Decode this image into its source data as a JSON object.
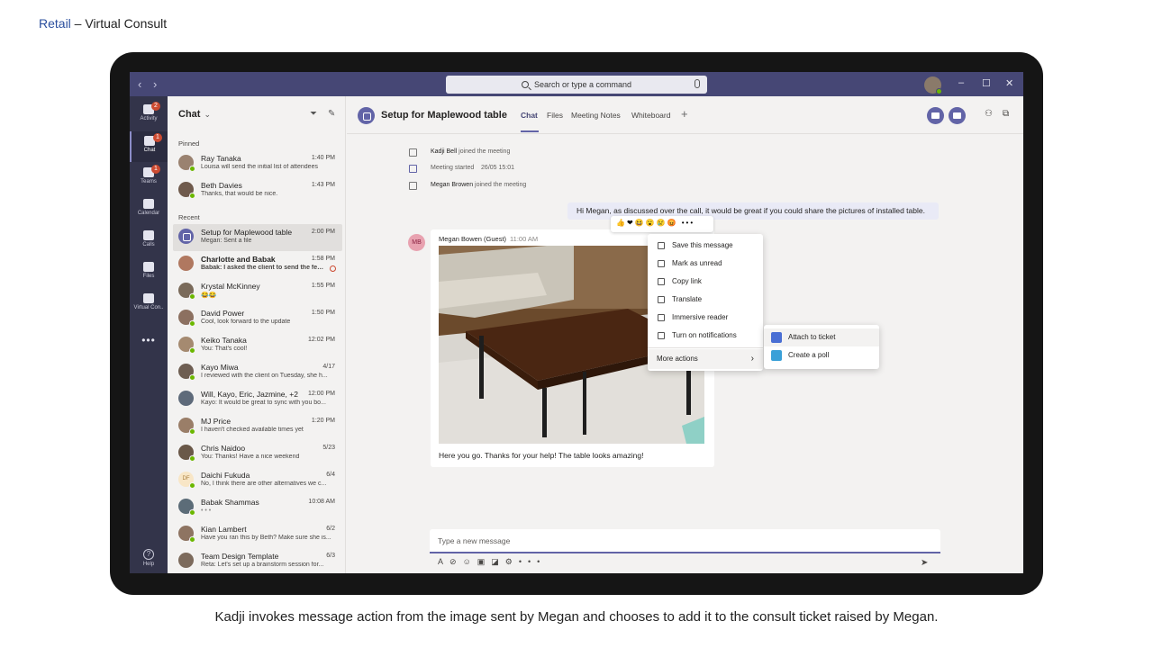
{
  "slide": {
    "title_accent": "Retail",
    "title_rest": " – Virtual Consult",
    "caption": "Kadji invokes message action from the image sent by Megan and chooses to add it to the consult ticket raised by Megan."
  },
  "titlebar": {
    "search_placeholder": "Search or type a command"
  },
  "rail": {
    "items": [
      {
        "label": "Activity",
        "icon": "bell-icon",
        "badge": "2"
      },
      {
        "label": "Chat",
        "icon": "chat-icon",
        "badge": "1"
      },
      {
        "label": "Teams",
        "icon": "teams-icon",
        "badge": "1"
      },
      {
        "label": "Calendar",
        "icon": "calendar-icon",
        "badge": ""
      },
      {
        "label": "Calls",
        "icon": "phone-icon",
        "badge": ""
      },
      {
        "label": "Files",
        "icon": "files-icon",
        "badge": ""
      },
      {
        "label": "Virtual Con..",
        "icon": "virtual-consult-icon",
        "badge": ""
      }
    ],
    "more": "•••",
    "help": "Help"
  },
  "chatlist": {
    "header": "Chat",
    "pinned_label": "Pinned",
    "recent_label": "Recent",
    "pinned": [
      {
        "name": "Ray Tanaka",
        "time": "1:40 PM",
        "preview": "Louisa will send the initial list of attendees"
      },
      {
        "name": "Beth Davies",
        "time": "1:43 PM",
        "preview": "Thanks, that would be nice."
      }
    ],
    "recent": [
      {
        "name": "Setup for Maplewood table",
        "time": "2:00 PM",
        "preview": "Megan: Sent a file"
      },
      {
        "name": "Charlotte and Babak",
        "time": "1:58 PM",
        "preview": "Babak: I asked the client to send the feedback"
      },
      {
        "name": "Krystal McKinney",
        "time": "1:55 PM",
        "preview": "😂😂"
      },
      {
        "name": "David Power",
        "time": "1:50 PM",
        "preview": "Cool, look forward to the update"
      },
      {
        "name": "Keiko Tanaka",
        "time": "12:02 PM",
        "preview": "You: That's cool!"
      },
      {
        "name": "Kayo Miwa",
        "time": "4/17",
        "preview": "I reviewed with the client on Tuesday, she h..."
      },
      {
        "name": "Will, Kayo, Eric, Jazmine, +2",
        "time": "12:00 PM",
        "preview": "Kayo: It would be great to sync with you bo..."
      },
      {
        "name": "MJ Price",
        "time": "1:20 PM",
        "preview": "I haven't checked available times yet"
      },
      {
        "name": "Chris Naidoo",
        "time": "5/23",
        "preview": "You: Thanks! Have a nice weekend"
      },
      {
        "name": "Daichi Fukuda",
        "time": "6/4",
        "preview": "No, I think there are other alternatives we c...",
        "initials": "DF"
      },
      {
        "name": "Babak Shammas",
        "time": "10:08 AM",
        "preview": "• • •"
      },
      {
        "name": "Kian Lambert",
        "time": "6/2",
        "preview": "Have you ran this by Beth? Make sure she is..."
      },
      {
        "name": "Team Design Template",
        "time": "6/3",
        "preview": "Reta: Let's set up a brainstorm session for..."
      }
    ]
  },
  "main": {
    "title": "Setup for Maplewood table",
    "tabs": [
      "Chat",
      "Files",
      "Meeting Notes",
      "Whiteboard"
    ],
    "system": [
      {
        "name": "Kadji Bell",
        "text": "joined the meeting"
      },
      {
        "name": "",
        "text": "Meeting started",
        "time": "26/05 15:01"
      },
      {
        "name": "Megan Browen",
        "text": "joined the meeting"
      }
    ],
    "sent_message": "Hi Megan, as discussed over the call, it would be great if you could share the pictures of installed table.",
    "reactions": "👍❤😆😮😢😡 •••",
    "incoming": {
      "initials": "MB",
      "sender": "Megan Bowen (Guest)",
      "time": "11:00 AM",
      "text": "Here you go. Thanks for your help! The table looks amazing!"
    },
    "compose_placeholder": "Type a new message"
  },
  "context_menu": {
    "items": [
      "Save this message",
      "Mark as unread",
      "Copy link",
      "Translate",
      "Immersive reader",
      "Turn on notifications"
    ],
    "more_actions": "More actions",
    "submenu": [
      "Attach to ticket",
      "Create a poll"
    ]
  },
  "colors": {
    "brand": "#6264a7",
    "titlebar": "#464775",
    "rail": "#33344a",
    "badge": "#cc4a31",
    "presence": "#6bb700"
  }
}
